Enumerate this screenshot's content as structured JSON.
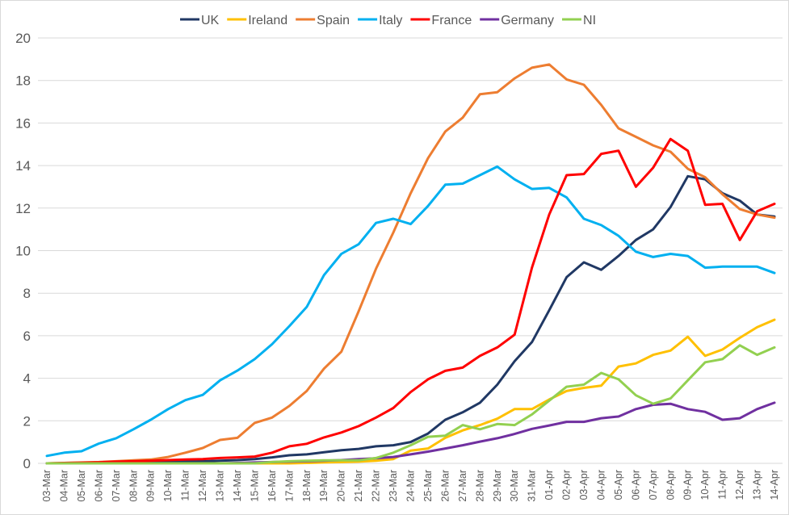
{
  "chart_data": {
    "type": "line",
    "title": "",
    "xlabel": "",
    "ylabel": "",
    "ylim": [
      0,
      20
    ],
    "yticks": [
      0,
      2,
      4,
      6,
      8,
      10,
      12,
      14,
      16,
      18,
      20
    ],
    "grid": true,
    "legend_position": "top",
    "x": [
      "03-Mar",
      "04-Mar",
      "05-Mar",
      "06-Mar",
      "07-Mar",
      "08-Mar",
      "09-Mar",
      "10-Mar",
      "11-Mar",
      "12-Mar",
      "13-Mar",
      "14-Mar",
      "15-Mar",
      "16-Mar",
      "17-Mar",
      "18-Mar",
      "19-Mar",
      "20-Mar",
      "21-Mar",
      "22-Mar",
      "23-Mar",
      "24-Mar",
      "25-Mar",
      "26-Mar",
      "27-Mar",
      "28-Mar",
      "29-Mar",
      "30-Mar",
      "31-Mar",
      "01-Apr",
      "02-Apr",
      "03-Apr",
      "04-Apr",
      "05-Apr",
      "06-Apr",
      "07-Apr",
      "08-Apr",
      "09-Apr",
      "10-Apr",
      "11-Apr",
      "12-Apr",
      "13-Apr",
      "14-Apr"
    ],
    "series": [
      {
        "name": "UK",
        "color": "#203864",
        "values": [
          0,
          0,
          0,
          0.02,
          0.03,
          0.04,
          0.05,
          0.06,
          0.08,
          0.1,
          0.12,
          0.15,
          0.2,
          0.28,
          0.38,
          0.42,
          0.52,
          0.62,
          0.68,
          0.8,
          0.85,
          1.0,
          1.4,
          2.05,
          2.4,
          2.85,
          3.7,
          4.8,
          5.7,
          7.2,
          8.75,
          9.45,
          9.1,
          9.75,
          10.5,
          11.0,
          12.05,
          13.5,
          13.35,
          12.7,
          12.35,
          11.7,
          11.6
        ]
      },
      {
        "name": "Ireland",
        "color": "#FFC000",
        "values": [
          0,
          0,
          0,
          0,
          0,
          0,
          0,
          0,
          0,
          0,
          0,
          0,
          0,
          0,
          0,
          0.02,
          0.04,
          0.06,
          0.08,
          0.12,
          0.2,
          0.6,
          0.7,
          1.2,
          1.55,
          1.8,
          2.1,
          2.55,
          2.55,
          3.0,
          3.4,
          3.55,
          3.65,
          4.55,
          4.7,
          5.1,
          5.3,
          5.95,
          5.05,
          5.35,
          5.9,
          6.4,
          6.75
        ]
      },
      {
        "name": "Spain",
        "color": "#ED7D31",
        "values": [
          0,
          0.02,
          0.04,
          0.06,
          0.1,
          0.14,
          0.18,
          0.3,
          0.5,
          0.72,
          1.1,
          1.2,
          1.9,
          2.15,
          2.7,
          3.4,
          4.45,
          5.25,
          7.15,
          9.15,
          10.85,
          12.7,
          14.35,
          15.6,
          16.25,
          17.35,
          17.45,
          18.1,
          18.6,
          18.75,
          18.05,
          17.8,
          16.85,
          15.75,
          15.35,
          14.95,
          14.65,
          13.85,
          13.45,
          12.65,
          11.95,
          11.7,
          11.55
        ]
      },
      {
        "name": "Italy",
        "color": "#00B0F0",
        "values": [
          0.35,
          0.5,
          0.57,
          0.93,
          1.18,
          1.6,
          2.05,
          2.55,
          2.97,
          3.22,
          3.9,
          4.36,
          4.9,
          5.6,
          6.45,
          7.35,
          8.85,
          9.85,
          10.3,
          11.3,
          11.5,
          11.25,
          12.1,
          13.1,
          13.15,
          13.55,
          13.95,
          13.35,
          12.9,
          12.95,
          12.5,
          11.5,
          11.2,
          10.7,
          9.95,
          9.7,
          9.85,
          9.75,
          9.2,
          9.25,
          9.25,
          9.25,
          8.95
        ]
      },
      {
        "name": "France",
        "color": "#FF0000",
        "values": [
          0,
          0.02,
          0.03,
          0.05,
          0.08,
          0.1,
          0.12,
          0.15,
          0.18,
          0.2,
          0.25,
          0.28,
          0.32,
          0.5,
          0.8,
          0.92,
          1.22,
          1.45,
          1.75,
          2.15,
          2.6,
          3.35,
          3.95,
          4.35,
          4.5,
          5.05,
          5.45,
          6.05,
          9.2,
          11.7,
          13.55,
          13.6,
          14.55,
          14.7,
          13.0,
          13.9,
          15.25,
          14.7,
          12.15,
          12.2,
          10.5,
          11.85,
          12.2
        ]
      },
      {
        "name": "Germany",
        "color": "#7030A0",
        "values": [
          0,
          0,
          0,
          0,
          0,
          0,
          0,
          0,
          0,
          0,
          0,
          0.02,
          0.04,
          0.06,
          0.08,
          0.1,
          0.12,
          0.15,
          0.2,
          0.24,
          0.3,
          0.42,
          0.55,
          0.7,
          0.85,
          1.02,
          1.18,
          1.38,
          1.62,
          1.78,
          1.95,
          1.95,
          2.12,
          2.2,
          2.55,
          2.75,
          2.8,
          2.55,
          2.42,
          2.05,
          2.12,
          2.55,
          2.85
        ]
      },
      {
        "name": "NI",
        "color": "#92D050",
        "values": [
          0,
          0,
          0,
          0,
          0,
          0,
          0,
          0,
          0,
          0,
          0,
          0,
          0,
          0.06,
          0.1,
          0.12,
          0.14,
          0.14,
          0.14,
          0.25,
          0.5,
          0.85,
          1.25,
          1.3,
          1.8,
          1.6,
          1.85,
          1.8,
          2.3,
          2.95,
          3.6,
          3.7,
          4.25,
          3.95,
          3.2,
          2.8,
          3.05,
          3.9,
          4.75,
          4.9,
          5.55,
          5.1,
          5.45
        ]
      }
    ]
  }
}
